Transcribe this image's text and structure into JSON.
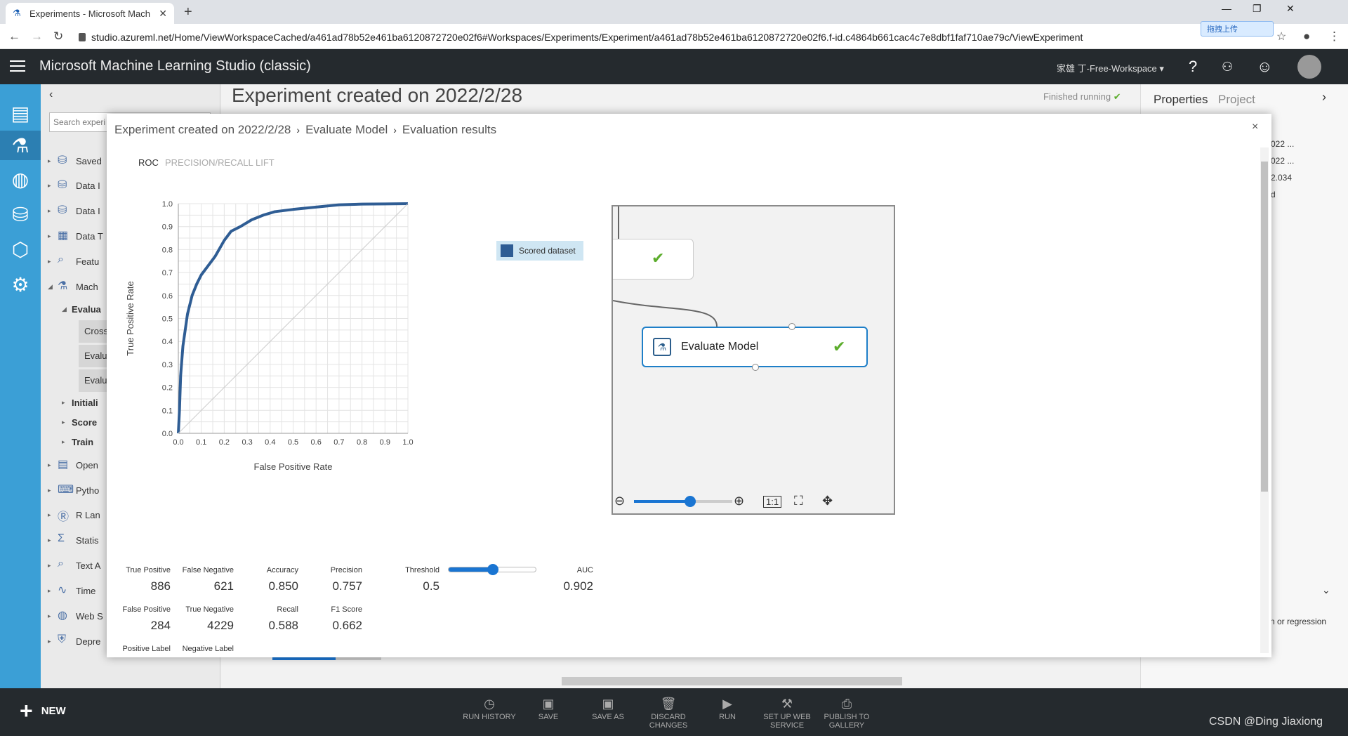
{
  "browser": {
    "tab_title": "Experiments - Microsoft Mach",
    "url": "studio.azureml.net/Home/ViewWorkspaceCached/a461ad78b52e461ba6120872720e02f6#Workspaces/Experiments/Experiment/a461ad78b52e461ba6120872720e02f6.f-id.c4864b661cac4c7e8dbf1faf710ae79c/ViewExperiment",
    "extension_label": "拖拽上传"
  },
  "app": {
    "title": "Microsoft Machine Learning Studio (classic)",
    "workspace": "家雄 丁-Free-Workspace"
  },
  "palette": {
    "search_placeholder": "Search experi",
    "items": [
      {
        "label": "Saved"
      },
      {
        "label": "Data I"
      },
      {
        "label": "Data I"
      },
      {
        "label": "Data T"
      },
      {
        "label": "Featu"
      },
      {
        "label": "Mach"
      },
      {
        "label": "Evalua"
      },
      {
        "label": "Cross"
      },
      {
        "label": "Evalu"
      },
      {
        "label": "Evalu"
      },
      {
        "label": "Initiali"
      },
      {
        "label": "Score"
      },
      {
        "label": "Train"
      },
      {
        "label": "Open"
      },
      {
        "label": "Pytho"
      },
      {
        "label": "R Lan"
      },
      {
        "label": "Statis"
      },
      {
        "label": "Text A"
      },
      {
        "label": "Time"
      },
      {
        "label": "Web S"
      },
      {
        "label": "Depre"
      }
    ]
  },
  "experiment": {
    "title": "Experiment created on 2022/2/28",
    "status": "Finished running"
  },
  "properties": {
    "tab_properties": "Properties",
    "tab_project": "Project",
    "lines": [
      "022 ...",
      "022 ...",
      "2.034",
      "d"
    ],
    "bottom_text": "n or regression"
  },
  "modal": {
    "breadcrumb": [
      "Experiment created on 2022/2/28",
      "Evaluate Model",
      "Evaluation results"
    ],
    "close": "×",
    "tabs": [
      "ROC",
      "PRECISION/RECALL",
      "LIFT"
    ],
    "legend": "Scored dataset",
    "minimap_node": "Evaluate Model",
    "metrics": {
      "true_positive_label": "True Positive",
      "true_positive": "886",
      "false_negative_label": "False Negative",
      "false_negative": "621",
      "false_positive_label": "False Positive",
      "false_positive": "284",
      "true_negative_label": "True Negative",
      "true_negative": "4229",
      "accuracy_label": "Accuracy",
      "accuracy": "0.850",
      "precision_label": "Precision",
      "precision": "0.757",
      "recall_label": "Recall",
      "recall": "0.588",
      "f1_label": "F1 Score",
      "f1": "0.662",
      "threshold_label": "Threshold",
      "threshold": "0.5",
      "threshold_fraction": 0.5,
      "auc_label": "AUC",
      "auc": "0.902",
      "positive_label": "Positive Label",
      "negative_label": "Negative Label"
    }
  },
  "toolbar": {
    "new": "NEW",
    "buttons": [
      "RUN HISTORY",
      "SAVE",
      "SAVE AS",
      "DISCARD CHANGES",
      "RUN",
      "SET UP WEB SERVICE",
      "PUBLISH TO GALLERY"
    ]
  },
  "watermark": "CSDN @Ding Jiaxiong",
  "chart_data": {
    "type": "line",
    "xlabel": "False Positive Rate",
    "ylabel": "True Positive Rate",
    "xlim": [
      0,
      1
    ],
    "ylim": [
      0,
      1
    ],
    "xticks": [
      "0.0",
      "0.1",
      "0.2",
      "0.3",
      "0.4",
      "0.5",
      "0.6",
      "0.7",
      "0.8",
      "0.9",
      "1.0"
    ],
    "yticks": [
      "0.0",
      "0.1",
      "0.2",
      "0.3",
      "0.4",
      "0.5",
      "0.6",
      "0.7",
      "0.8",
      "0.9",
      "1.0"
    ],
    "grid": true,
    "series": [
      {
        "name": "Scored dataset",
        "color": "#2f5d94",
        "x": [
          0,
          0.005,
          0.01,
          0.02,
          0.03,
          0.04,
          0.06,
          0.08,
          0.1,
          0.13,
          0.16,
          0.2,
          0.23,
          0.27,
          0.32,
          0.37,
          0.42,
          0.5,
          0.6,
          0.7,
          0.8,
          0.9,
          1.0
        ],
        "y": [
          0,
          0.1,
          0.25,
          0.38,
          0.45,
          0.52,
          0.6,
          0.65,
          0.69,
          0.73,
          0.77,
          0.84,
          0.88,
          0.9,
          0.93,
          0.95,
          0.965,
          0.975,
          0.985,
          0.995,
          0.998,
          0.999,
          1.0
        ]
      },
      {
        "name": "",
        "color": "#cccccc",
        "x": [
          0,
          1
        ],
        "y": [
          0,
          1
        ]
      }
    ]
  }
}
